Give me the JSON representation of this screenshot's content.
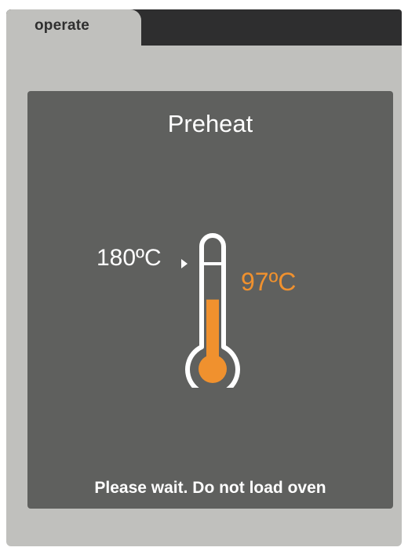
{
  "tabs": {
    "active_label": "operate"
  },
  "panel": {
    "title": "Preheat",
    "target_temperature": "180ºC",
    "current_temperature": "97ºC",
    "status_message": "Please wait. Do not load oven"
  },
  "thermometer": {
    "fill_fraction": 0.54,
    "fill_color": "#f0912e",
    "outline_color": "#ffffff"
  },
  "colors": {
    "frame": "#c0c0bd",
    "tab_strip": "#2e2e2f",
    "panel": "#5f605e",
    "accent": "#f0912e"
  }
}
